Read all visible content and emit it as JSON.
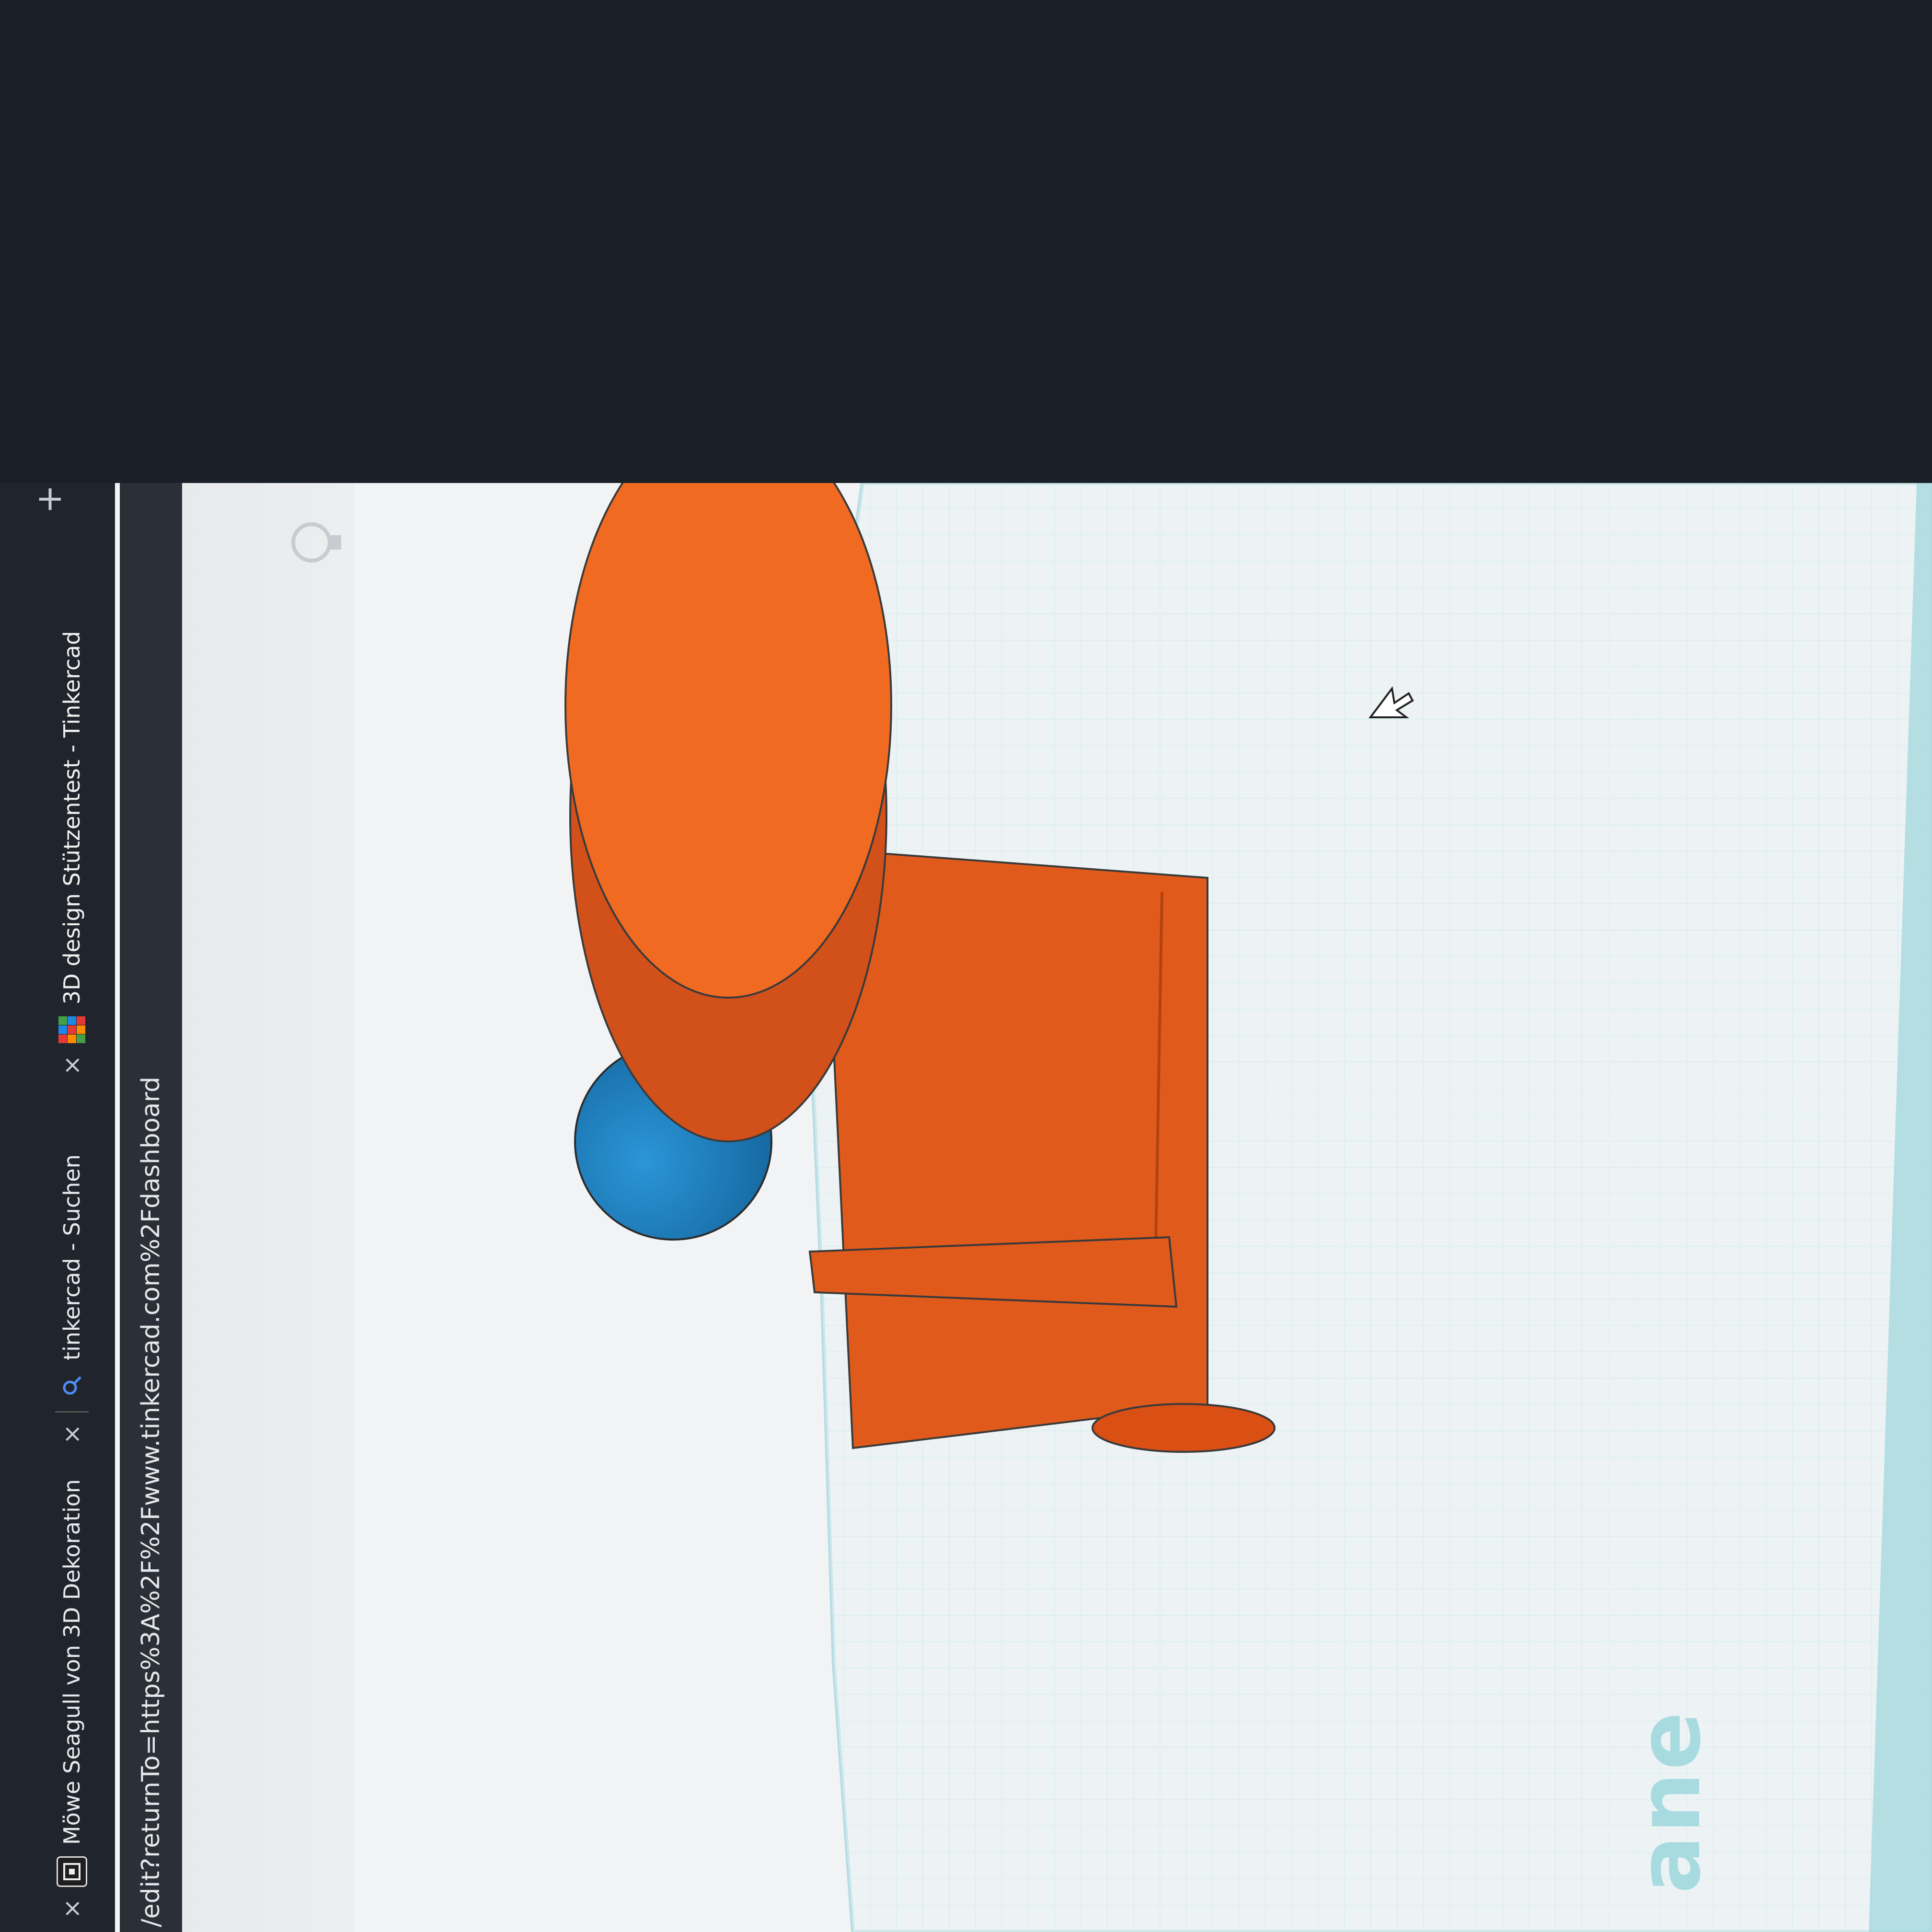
{
  "browser": {
    "tabs": [
      {
        "title": "Möwe Seagull von 3D Dekoration",
        "favicon": "thingiverse-icon",
        "active": false
      },
      {
        "title": "tinkercad - Suchen",
        "favicon": "search-icon",
        "active": false
      },
      {
        "title": "3D design Stützentest - Tinkercad",
        "favicon": "tinkercad-logo-icon",
        "active": true
      }
    ],
    "close_glyph": "×",
    "new_tab_glyph": "+",
    "url": "/edit?returnTo=https%3A%2F%2Fwww.tinkercad.com%2Fdashboard"
  },
  "workplane": {
    "label_fragment": "ane",
    "grid_color": "#bfe3e8",
    "edge_color": "#8fd0d8"
  },
  "scene_objects": [
    {
      "name": "sphere",
      "color": "#1f86c8"
    },
    {
      "name": "vertical-rod",
      "color": "#e05a1c"
    },
    {
      "name": "horizontal-rod",
      "color": "#e05a1c"
    },
    {
      "name": "disc",
      "color": "#f06a22"
    }
  ],
  "icons": [
    "lightbulb-icon",
    "cursor-arrow-icon"
  ]
}
